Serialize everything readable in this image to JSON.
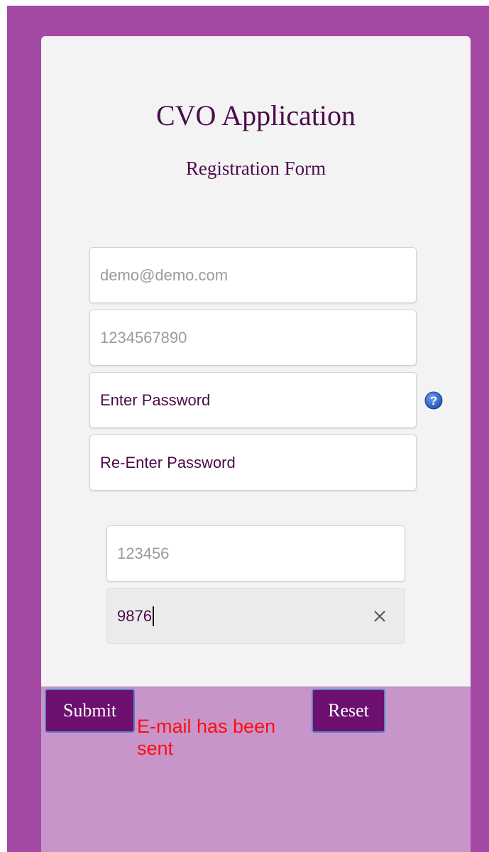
{
  "form": {
    "title": "CVO Application",
    "subtitle": "Registration Form"
  },
  "fields": {
    "email": {
      "placeholder": "demo@demo.com"
    },
    "phone": {
      "placeholder": "1234567890"
    },
    "password": {
      "value": "Enter Password"
    },
    "confirm_password": {
      "value": "Re-Enter Password"
    },
    "code_1": {
      "placeholder": "123456"
    },
    "code_2": {
      "value": "9876"
    }
  },
  "icons": {
    "help": "help-icon",
    "clear": "close-icon"
  },
  "buttons": {
    "submit": "Submit",
    "reset": "Reset"
  },
  "status": {
    "message": "E-mail has been sent"
  },
  "colors": {
    "page_background": "#a349a4",
    "card_background": "#f3f3f3",
    "footer_background": "#c895cb",
    "heading": "#4c0b4c",
    "button": "#6d0f6e",
    "status_error": "#ff0d0d",
    "help_icon": "#2f66c7"
  }
}
